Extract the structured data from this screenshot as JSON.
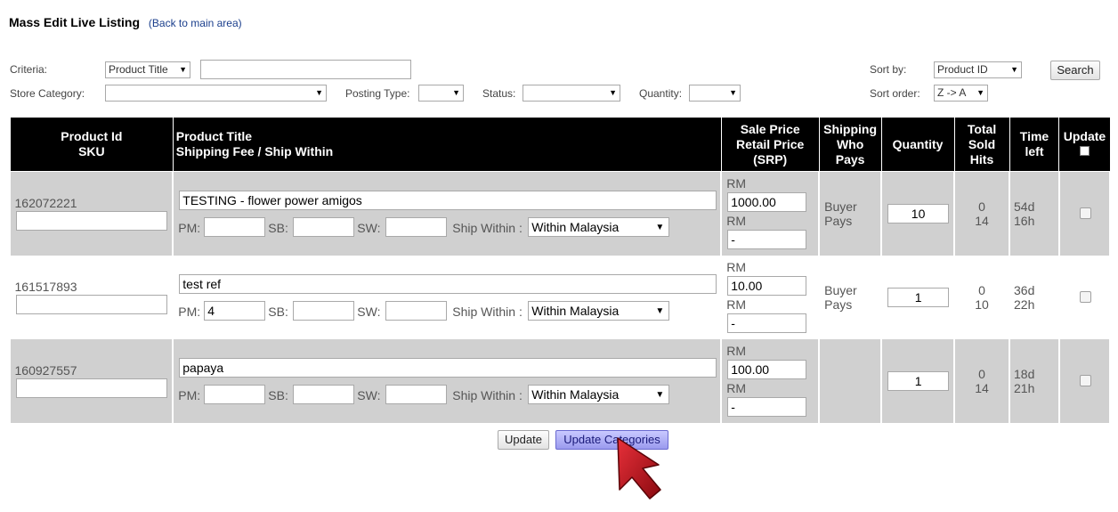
{
  "header": {
    "title": "Mass Edit Live Listing",
    "back_link": "(Back to main area)"
  },
  "filters": {
    "criteria_label": "Criteria:",
    "criteria_value": "Product Title",
    "criteria_text": "",
    "store_category_label": "Store Category:",
    "store_category_value": "",
    "posting_type_label": "Posting Type:",
    "posting_type_value": "",
    "status_label": "Status:",
    "status_value": "",
    "quantity_label": "Quantity:",
    "quantity_value": "",
    "sort_by_label": "Sort by:",
    "sort_by_value": "Product ID",
    "sort_order_label": "Sort order:",
    "sort_order_value": "Z -> A",
    "search_button": "Search"
  },
  "table": {
    "headers": {
      "product_id": "Product Id",
      "sku": "SKU",
      "product_title": "Product Title",
      "shipping_fee": "Shipping Fee / Ship Within",
      "sale_price": "Sale Price",
      "retail_price": "Retail Price",
      "srp": "(SRP)",
      "shipping": "Shipping",
      "who": "Who",
      "pays": "Pays",
      "quantity": "Quantity",
      "total": "Total",
      "sold": "Sold",
      "hits": "Hits",
      "time": "Time",
      "left": "left",
      "update": "Update"
    },
    "labels": {
      "pm": "PM:",
      "sb": "SB:",
      "sw": "SW:",
      "ship_within": "Ship Within :",
      "rm": "RM"
    },
    "rows": [
      {
        "id": "162072221",
        "sku": "",
        "title": "TESTING - flower power amigos",
        "pm": "",
        "sb": "",
        "sw": "",
        "ship_within": "Within Malaysia",
        "sale_price": "1000.00",
        "retail_price": "-",
        "who_pays_1": "Buyer",
        "who_pays_2": "Pays",
        "quantity": "10",
        "sold": "0",
        "hits": "14",
        "time_1": "54d",
        "time_2": "16h"
      },
      {
        "id": "161517893",
        "sku": "",
        "title": "test ref",
        "pm": "4",
        "sb": "",
        "sw": "",
        "ship_within": "Within Malaysia",
        "sale_price": "10.00",
        "retail_price": "-",
        "who_pays_1": "Buyer",
        "who_pays_2": "Pays",
        "quantity": "1",
        "sold": "0",
        "hits": "10",
        "time_1": "36d",
        "time_2": "22h"
      },
      {
        "id": "160927557",
        "sku": "",
        "title": "papaya",
        "pm": "",
        "sb": "",
        "sw": "",
        "ship_within": "Within Malaysia",
        "sale_price": "100.00",
        "retail_price": "-",
        "who_pays_1": "",
        "who_pays_2": "",
        "quantity": "1",
        "sold": "0",
        "hits": "14",
        "time_1": "18d",
        "time_2": "21h"
      }
    ]
  },
  "actions": {
    "update": "Update",
    "update_categories": "Update Categories"
  },
  "colors": {
    "header_bg": "#000000",
    "row_alt": "#d0d0d0",
    "accent_button": "#9a9aee",
    "pointer": "#c0141c"
  }
}
